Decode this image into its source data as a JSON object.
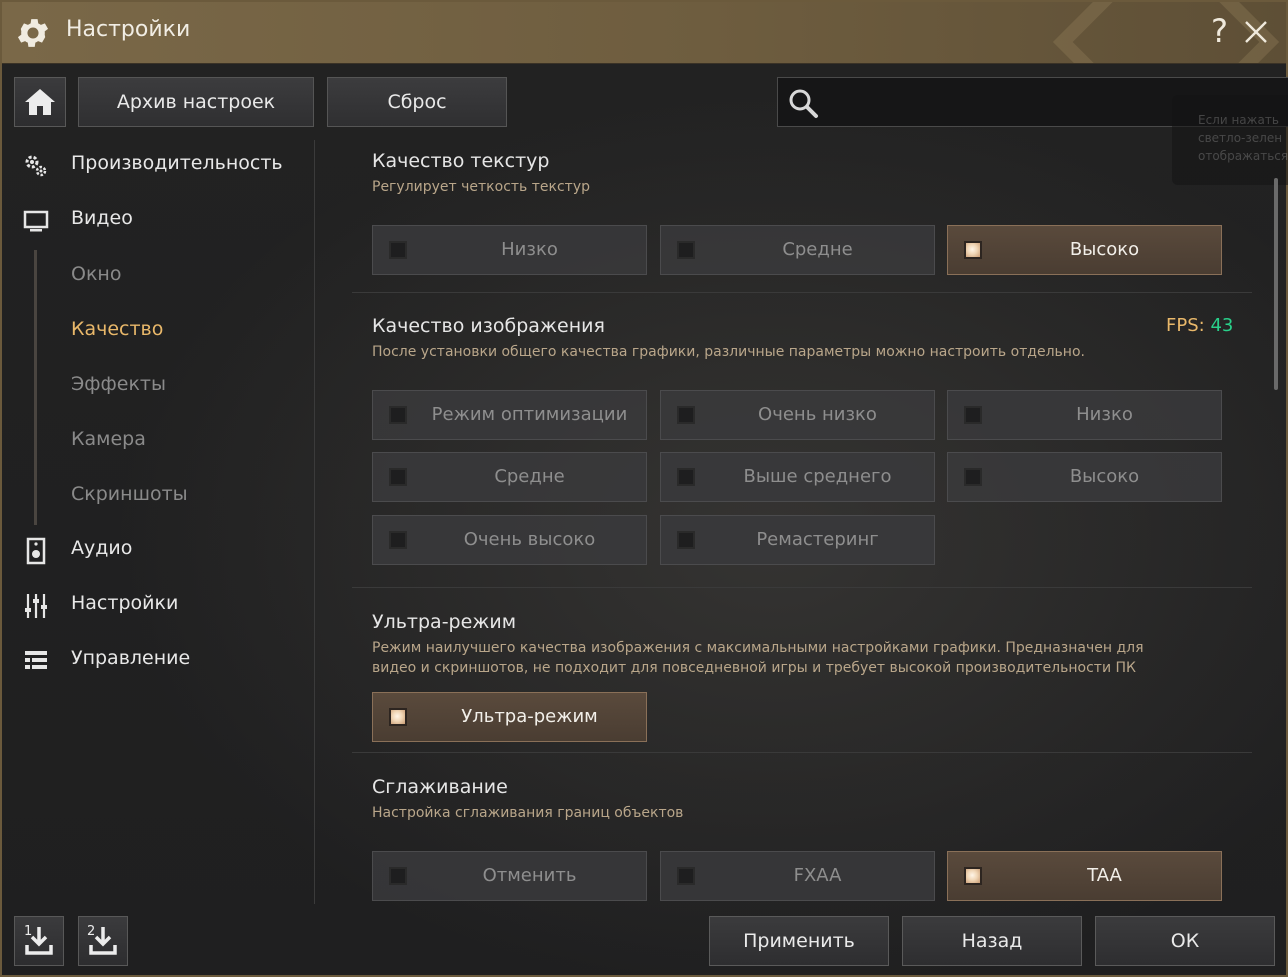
{
  "window": {
    "title": "Настройки",
    "help_label": "?"
  },
  "toolbar": {
    "archive_label": "Архив настроек",
    "reset_label": "Сброс",
    "search_placeholder": ""
  },
  "tooltip": {
    "lines": [
      "Если нажать",
      "светло-зелен",
      "отображаться"
    ]
  },
  "sidebar": {
    "items": [
      {
        "label": "Производительность",
        "icon": "gears-icon"
      },
      {
        "label": "Видео",
        "icon": "monitor-icon"
      },
      {
        "label": "Аудио",
        "icon": "speaker-icon"
      },
      {
        "label": "Настройки",
        "icon": "sliders-icon"
      },
      {
        "label": "Управление",
        "icon": "list-icon"
      }
    ],
    "subitems": [
      {
        "label": "Окно"
      },
      {
        "label": "Качество",
        "active": true
      },
      {
        "label": "Эффекты"
      },
      {
        "label": "Камера"
      },
      {
        "label": "Скриншоты"
      }
    ]
  },
  "sections": {
    "texture": {
      "title": "Качество текстур",
      "desc": "Регулирует четкость текстур",
      "options": [
        {
          "label": "Низко",
          "selected": false
        },
        {
          "label": "Средне",
          "selected": false
        },
        {
          "label": "Высоко",
          "selected": true
        }
      ]
    },
    "image": {
      "title": "Качество изображения",
      "desc": "После установки общего качества графики, различные параметры можно настроить отдельно.",
      "fps_label": "FPS:",
      "fps_value": "43",
      "options": [
        {
          "label": "Режим оптимизации",
          "selected": false
        },
        {
          "label": "Очень низко",
          "selected": false
        },
        {
          "label": "Низко",
          "selected": false
        },
        {
          "label": "Средне",
          "selected": false
        },
        {
          "label": "Выше среднего",
          "selected": false
        },
        {
          "label": "Высоко",
          "selected": false
        },
        {
          "label": "Очень высоко",
          "selected": false
        },
        {
          "label": "Ремастеринг",
          "selected": false
        }
      ]
    },
    "ultra": {
      "title": "Ультра-режим",
      "desc_line1": "Режим наилучшего качества изображения с максимальными настройками графики. Предназначен для",
      "desc_line2": "видео и скриншотов, не подходит для повседневной игры и требует высокой производительности ПК",
      "options": [
        {
          "label": "Ультра-режим",
          "selected": true
        }
      ]
    },
    "aa": {
      "title": "Сглаживание",
      "desc": "Настройка сглаживания границ объектов",
      "options": [
        {
          "label": "Отменить",
          "selected": false
        },
        {
          "label": "FXAA",
          "selected": false
        },
        {
          "label": "TAA",
          "selected": true
        }
      ]
    }
  },
  "bottom": {
    "slot1_label": "1",
    "slot2_label": "2",
    "apply_label": "Применить",
    "back_label": "Назад",
    "ok_label": "ОК"
  },
  "colors": {
    "accent": "#e9b86a",
    "fps_value": "#29d08a",
    "titlebar": "#7a6848",
    "desc": "#b9a68a"
  }
}
